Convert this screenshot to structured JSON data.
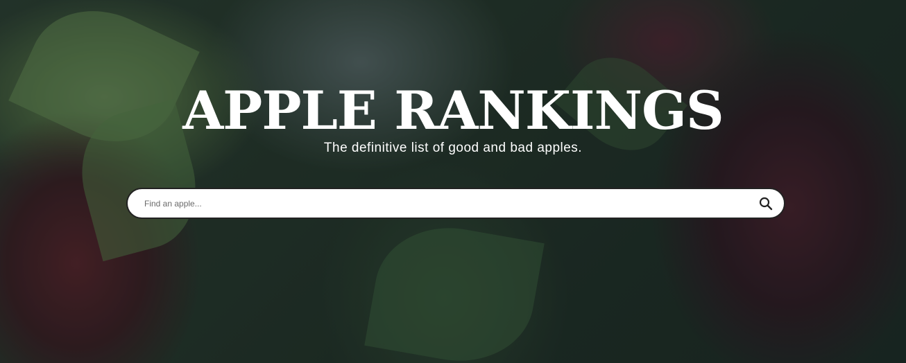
{
  "hero": {
    "title": "APPLE RANKINGS",
    "subtitle": "The definitive list of good and bad apples."
  },
  "search": {
    "placeholder": "Find an apple...",
    "value": "",
    "icon": "search-icon"
  },
  "colors": {
    "title_text": "#ffffff",
    "search_background": "#ffffff",
    "search_border": "#222222"
  }
}
